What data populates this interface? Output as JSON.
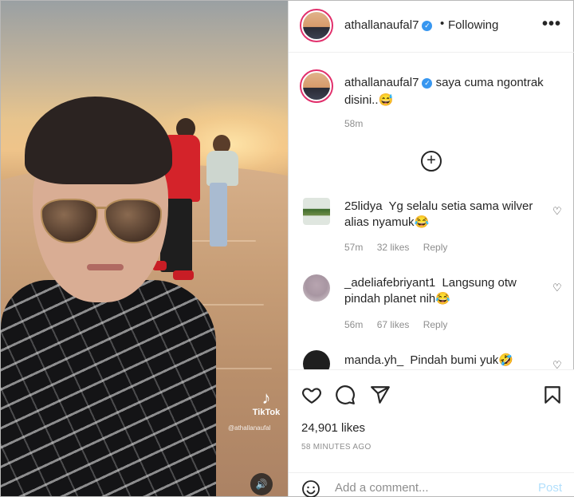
{
  "post": {
    "username": "athallanaufal7",
    "verified_glyph": "✓",
    "separator": "•",
    "follow_status": "Following",
    "more_glyph": "•••"
  },
  "caption": {
    "username": "athallanaufal7",
    "text": "saya cuma ngontrak disini..😅",
    "time": "58m"
  },
  "load_more_glyph": "+",
  "comments": [
    {
      "username": "25lidya",
      "text": "Yg selalu setia sama wilver alias nyamuk😂",
      "time": "57m",
      "likes": "32 likes",
      "reply": "Reply"
    },
    {
      "username": "_adeliafebriyant1",
      "text": "Langsung otw pindah planet nih😂",
      "time": "56m",
      "likes": "67 likes",
      "reply": "Reply"
    },
    {
      "username": "manda.yh_",
      "text": "Pindah bumi yuk🤣"
    }
  ],
  "heart_glyph": "♡",
  "media": {
    "tiktok_label": "TikTok",
    "tiktok_glyph": "♪",
    "tiktok_user": "@athallanaufal",
    "sound_glyph": "🔊"
  },
  "footer": {
    "likes": "24,901 likes",
    "posted_ago": "58 MINUTES AGO",
    "comment_placeholder": "Add a comment...",
    "post_label": "Post"
  },
  "icons": [
    "like-icon",
    "comment-icon",
    "share-icon",
    "save-icon",
    "emoji-icon",
    "verified-icon",
    "more-icon",
    "add-icon",
    "heart-icon",
    "sound-icon",
    "tiktok-icon"
  ],
  "colors": {
    "verified": "#3897f0",
    "post_disabled": "#b2dffc",
    "muted": "#8e8e8e",
    "text": "#262626"
  }
}
